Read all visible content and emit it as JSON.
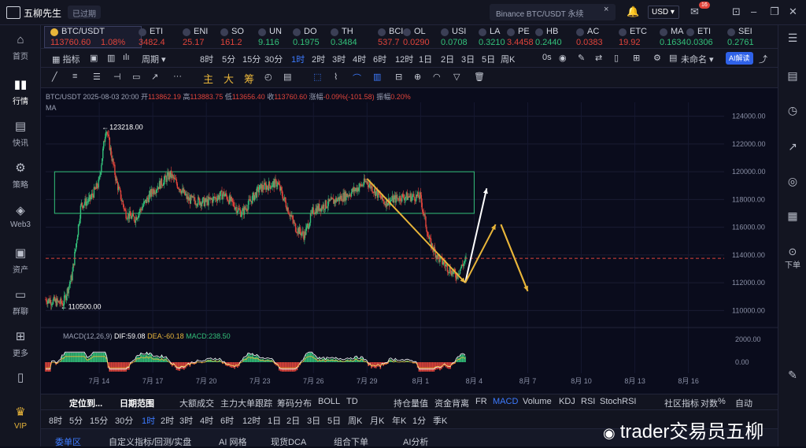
{
  "app": {
    "name": "五柳先生",
    "expired": "已过期"
  },
  "topbar": {
    "search_placeholder": "Binance BTC/USDT 永续",
    "currency": "USD",
    "notif_count": "16"
  },
  "left_nav": [
    {
      "label": "首页",
      "icon": "home-icon"
    },
    {
      "label": "行情",
      "icon": "bar-chart-icon"
    },
    {
      "label": "快讯",
      "icon": "news-icon"
    },
    {
      "label": "策略",
      "icon": "robot-icon"
    },
    {
      "label": "Web3",
      "icon": "web3-icon"
    },
    {
      "label": "资产",
      "icon": "wallet-icon"
    },
    {
      "label": "群聊",
      "icon": "chat-icon"
    },
    {
      "label": "更多",
      "icon": "more-icon"
    },
    {
      "label": "VIP",
      "icon": "vip-icon"
    }
  ],
  "right_nav": {
    "down_label": "下单"
  },
  "tickers": [
    {
      "name": "BTC/USDT",
      "price": "113760.60",
      "change": "1.08%",
      "dir": "down"
    },
    {
      "name": "ETI",
      "price": "3482.4",
      "dir": "down"
    },
    {
      "name": "ENI",
      "price": "25.17",
      "dir": "down"
    },
    {
      "name": "SO",
      "price": "161.2",
      "dir": "down"
    },
    {
      "name": "UN",
      "price": "9.116",
      "dir": "up"
    },
    {
      "name": "DO",
      "price": "0.1975",
      "dir": "up"
    },
    {
      "name": "TH",
      "price": "0.3484",
      "dir": "up"
    },
    {
      "name": "BCI",
      "price": "537.7",
      "dir": "down"
    },
    {
      "name": "OL",
      "price": "0.0290",
      "dir": "down"
    },
    {
      "name": "USI",
      "price": "0.0708",
      "dir": "up"
    },
    {
      "name": "LA",
      "price": "0.3210",
      "dir": "up"
    },
    {
      "name": "PE",
      "price": "3.4458",
      "dir": "down"
    },
    {
      "name": "HB",
      "price": "0.2440",
      "dir": "up"
    },
    {
      "name": "AC",
      "price": "0.0383",
      "dir": "down"
    },
    {
      "name": "ETC",
      "price": "19.92",
      "dir": "down"
    },
    {
      "name": "MA",
      "price": "0.1634",
      "dir": "up"
    },
    {
      "name": "ETI",
      "price": "0.0306",
      "dir": "up"
    },
    {
      "name": "SEI",
      "price": "0.2761",
      "dir": "up"
    }
  ],
  "toolbar1": {
    "items": [
      "指标",
      "周期",
      "8时",
      "5分",
      "15分",
      "30分",
      "1时",
      "2时",
      "3时",
      "4时",
      "6时",
      "12时",
      "1日",
      "2日",
      "3日",
      "5日",
      "周K"
    ],
    "selected": "1时",
    "seconds": "0s",
    "unnamed": "未命名",
    "ai": "AI解读"
  },
  "toolbar2": {
    "chars": [
      "主",
      "大",
      "筹"
    ]
  },
  "chart_info": {
    "symbol": "BTC/USDT",
    "time": "2025-08-03 20:00",
    "open_label": "开",
    "open": "113862.19",
    "high_label": "高",
    "high": "113883.75",
    "low_label": "低",
    "low": "113656.40",
    "close_label": "收",
    "close": "113760.60",
    "change_label": "涨幅",
    "change": "-0.09%(-101.58)",
    "amp_label": "振幅",
    "amp": "0.20%",
    "ma": "MA"
  },
  "macd_info": {
    "title": "MACD(12,26,9)",
    "dif": "DIF:59.08",
    "dea": "DEA:-60.18",
    "macd": "MACD:238.50"
  },
  "chart_data": {
    "type": "candlestick",
    "symbol": "BTC/USDT",
    "interval": "1时",
    "price_axis_ticks": [
      "124000.00",
      "122000.00",
      "120000.00",
      "118000.00",
      "116000.00",
      "114000.00",
      "112000.00",
      "110000.00"
    ],
    "macd_axis_ticks": [
      "2000.00",
      "0.00"
    ],
    "x_tick_labels": [
      "7月 14",
      "7月 17",
      "7月 20",
      "7月 23",
      "7月 26",
      "7月 29",
      "8月 1",
      "8月 4",
      "8月 7",
      "8月 10",
      "8月 13",
      "8月 16"
    ],
    "high_marker": "123218.00",
    "low_marker": "110500.00",
    "last_price": "113760.60",
    "ylim": [
      109000,
      125000
    ],
    "xlim_days": [
      "2025-07-11",
      "2025-08-18"
    ],
    "path": [
      [
        "2025-07-11",
        110800
      ],
      [
        "2025-07-12",
        110500
      ],
      [
        "2025-07-12.5",
        112500
      ],
      [
        "2025-07-13",
        117600
      ],
      [
        "2025-07-13.5",
        118000
      ],
      [
        "2025-07-14",
        119200
      ],
      [
        "2025-07-14.4",
        123218
      ],
      [
        "2025-07-15",
        119200
      ],
      [
        "2025-07-15.5",
        117000
      ],
      [
        "2025-07-16",
        116600
      ],
      [
        "2025-07-17",
        118600
      ],
      [
        "2025-07-18",
        119800
      ],
      [
        "2025-07-19",
        118000
      ],
      [
        "2025-07-20",
        117800
      ],
      [
        "2025-07-21",
        118400
      ],
      [
        "2025-07-22",
        117000
      ],
      [
        "2025-07-23",
        118800
      ],
      [
        "2025-07-24",
        119200
      ],
      [
        "2025-07-25",
        116000
      ],
      [
        "2025-07-25.5",
        115400
      ],
      [
        "2025-07-26",
        117200
      ],
      [
        "2025-07-27",
        117800
      ],
      [
        "2025-07-28",
        118400
      ],
      [
        "2025-07-29",
        119300
      ],
      [
        "2025-07-30",
        117800
      ],
      [
        "2025-07-31",
        118200
      ],
      [
        "2025-08-01",
        118200
      ],
      [
        "2025-08-01.5",
        115000
      ],
      [
        "2025-08-02",
        113800
      ],
      [
        "2025-08-03",
        112500
      ],
      [
        "2025-08-03.6",
        113760
      ]
    ],
    "range_box": {
      "top": 120000,
      "bottom": 117000,
      "start": "2025-07-11.5",
      "end": "2025-08-04"
    }
  },
  "bottom1": {
    "items": [
      "定位到...",
      "日期范围",
      "大额成交",
      "主力大单跟踪",
      "筹码分布",
      "BOLL",
      "TD",
      "持仓量值",
      "资金背离",
      "FR",
      "MACD",
      "Volume",
      "KDJ",
      "RSI",
      "StochRSI",
      "社区指标",
      "对数",
      "%",
      "自动"
    ],
    "selected": "MACD"
  },
  "bottom2": {
    "items": [
      "8时",
      "5分",
      "15分",
      "30分",
      "1时",
      "2时",
      "3时",
      "4时",
      "6时",
      "12时",
      "1日",
      "2日",
      "3日",
      "5日",
      "周K",
      "月K",
      "年K",
      "1分",
      "季K"
    ],
    "selected": "1时"
  },
  "bottom3": {
    "items": [
      "委单区",
      "自定义指标/回测/实盘",
      "AI 网格",
      "现货DCA",
      "组合下单",
      "AI分析"
    ]
  },
  "watermark": "trader交易员五柳",
  "colors": {
    "up": "#33c07a",
    "down": "#e0443b",
    "accent": "#3d7bff",
    "macd_dea": "#e8b53a",
    "range_box": "#33c07a"
  }
}
